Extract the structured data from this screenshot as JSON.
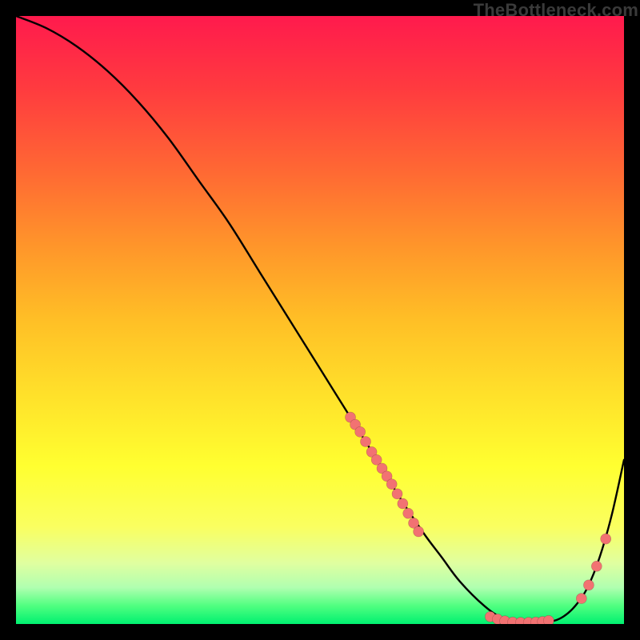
{
  "watermark": "TheBottleneck.com",
  "gradient": {
    "top": "#ff1a4d",
    "mid": "#ffe02a",
    "bottom": "#00f070"
  },
  "chart_data": {
    "type": "line",
    "title": "",
    "xlabel": "",
    "ylabel": "",
    "xlim": [
      0,
      100
    ],
    "ylim": [
      0,
      100
    ],
    "grid": false,
    "legend": false,
    "series": [
      {
        "name": "curve",
        "x": [
          0,
          5,
          10,
          15,
          20,
          25,
          30,
          35,
          40,
          45,
          50,
          55,
          60,
          63,
          67,
          70,
          73,
          77,
          80,
          83,
          86,
          88,
          90,
          92,
          94,
          96,
          98,
          100
        ],
        "y": [
          100,
          98,
          95,
          91,
          86,
          80,
          73,
          66,
          58,
          50,
          42,
          34,
          26,
          21,
          15,
          11,
          7,
          3,
          1,
          0.3,
          0.2,
          0.4,
          1.2,
          3,
          6,
          11,
          18,
          27
        ]
      }
    ],
    "clusters": [
      {
        "name": "cluster-a",
        "points": [
          {
            "x": 55,
            "y": 34
          },
          {
            "x": 55.8,
            "y": 32.8
          },
          {
            "x": 56.6,
            "y": 31.6
          },
          {
            "x": 57.5,
            "y": 30
          },
          {
            "x": 58.5,
            "y": 28.3
          },
          {
            "x": 59.3,
            "y": 27
          },
          {
            "x": 60.2,
            "y": 25.6
          },
          {
            "x": 61,
            "y": 24.3
          },
          {
            "x": 61.8,
            "y": 23
          },
          {
            "x": 62.7,
            "y": 21.4
          },
          {
            "x": 63.6,
            "y": 19.8
          },
          {
            "x": 64.5,
            "y": 18.2
          },
          {
            "x": 65.4,
            "y": 16.6
          },
          {
            "x": 66.2,
            "y": 15.2
          }
        ]
      },
      {
        "name": "cluster-b",
        "points": [
          {
            "x": 78,
            "y": 1.2
          },
          {
            "x": 79.2,
            "y": 0.8
          },
          {
            "x": 80.4,
            "y": 0.5
          },
          {
            "x": 81.7,
            "y": 0.3
          },
          {
            "x": 83,
            "y": 0.25
          },
          {
            "x": 84.3,
            "y": 0.25
          },
          {
            "x": 85.5,
            "y": 0.3
          },
          {
            "x": 86.6,
            "y": 0.4
          },
          {
            "x": 87.6,
            "y": 0.55
          }
        ]
      },
      {
        "name": "cluster-c",
        "points": [
          {
            "x": 93,
            "y": 4.2
          },
          {
            "x": 94.2,
            "y": 6.4
          },
          {
            "x": 95.5,
            "y": 9.5
          },
          {
            "x": 97,
            "y": 14
          }
        ]
      }
    ]
  }
}
